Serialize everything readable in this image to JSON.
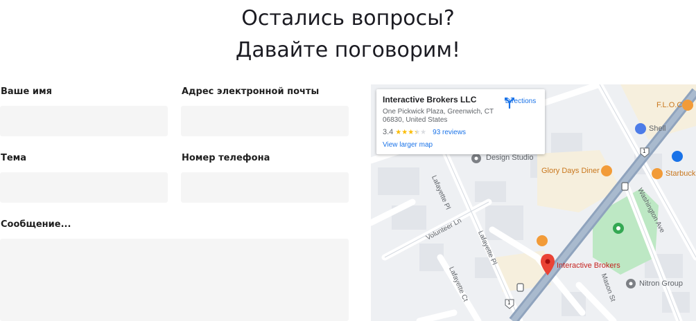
{
  "heading": {
    "line1": "Остались вопросы?",
    "line2": "Давайте поговорим!"
  },
  "form": {
    "name_label": "Ваше имя",
    "email_label": "Адрес электронной почты",
    "subject_label": "Тема",
    "phone_label": "Номер телефона",
    "message_label": "Сообщение..."
  },
  "map": {
    "card": {
      "title": "Interactive Brokers LLC",
      "address": "One Pickwick Plaza, Greenwich, CT 06830, United States",
      "rating": "3.4",
      "rating_value": 3.4,
      "reviews": "93 reviews",
      "directions": "Directions",
      "larger_map": "View larger map"
    },
    "places": {
      "floc": "F.L.O.C",
      "shell": "Shell",
      "starbucks": "Starbuck",
      "design_studio": "Design Studio",
      "glory_days": "Glory Days Diner",
      "interactive_brokers": "Interactive Brokers",
      "nitron": "Nitron Group"
    },
    "streets": {
      "lafayette_pl_1": "Lafayette Pl",
      "lafayette_pl_2": "Lafayette Pl",
      "lafayette_ct": "Lafayette Ct",
      "volunteer_ln": "Volunteer Ln",
      "washington_ave": "Washington Ave",
      "mason_st": "Mason St",
      "route_1a": "1",
      "route_1b": "1"
    },
    "colors": {
      "highway": "#8fa3bd",
      "park": "#bde8c4",
      "marker": "#ea4335",
      "food": "#f29b38",
      "link": "#1a73e8"
    }
  }
}
